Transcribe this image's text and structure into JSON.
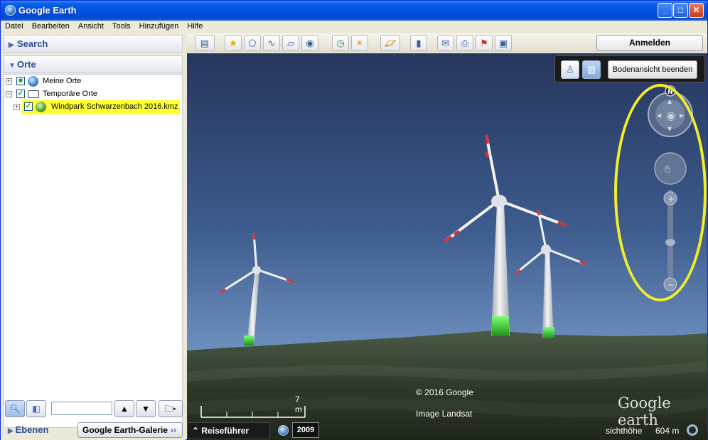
{
  "window": {
    "title": "Google Earth",
    "controls": {
      "minimize": "_",
      "maximize": "□",
      "close": "✕"
    }
  },
  "menu": [
    "Datei",
    "Bearbeiten",
    "Ansicht",
    "Tools",
    "Hinzufügen",
    "Hilfe"
  ],
  "sidebar": {
    "search_title": "Search",
    "places_title": "Orte",
    "tree": [
      {
        "label": "Meine Orte",
        "expander": "+",
        "checked": false,
        "icon": "globe-icon"
      },
      {
        "label": "Temporäre Orte",
        "expander": "−",
        "checked": true,
        "icon": "folder-icon"
      },
      {
        "label": "Windpark Schwarzenbach 2016.kmz",
        "expander": "+",
        "checked": true,
        "icon": "kmz-icon",
        "highlight_color": "#ffff33"
      }
    ],
    "search_value": "",
    "layers_title": "Ebenen",
    "gallery_label": "Google Earth-Galerie",
    "gallery_arrow": "››"
  },
  "toolbar": {
    "icons": [
      "sidebar-toggle-icon",
      "placemark-icon",
      "polygon-icon",
      "path-icon",
      "image-overlay-icon",
      "record-tour-icon",
      "historical-imagery-icon",
      "sunlight-icon",
      "planets-icon",
      "ruler-icon",
      "email-icon",
      "print-icon",
      "maps-icon",
      "save-image-icon"
    ],
    "signin_label": "Anmelden"
  },
  "view": {
    "groundview_exit_label": "Bodenansicht beenden",
    "north_label": "N",
    "copyright": "© 2016 Google",
    "imagery": "Image Landsat",
    "logo": "Google earth",
    "scale_label": "7  m",
    "guide_label": "Reiseführer",
    "year": "2009",
    "eye_altitude_label": "sichthöhe",
    "eye_altitude_value": "604 m",
    "highlight_color": "#f3ee27",
    "accent_blue": "#0054e3"
  }
}
